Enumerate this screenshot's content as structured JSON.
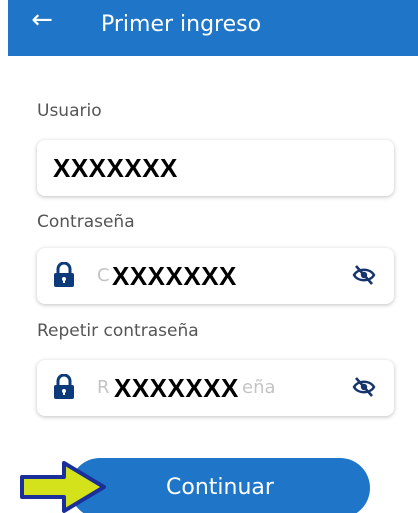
{
  "header": {
    "back_icon": "arrow-left-icon",
    "title": "Primer ingreso"
  },
  "form": {
    "usuario": {
      "label": "Usuario",
      "value": "XXXXXXX"
    },
    "contrasena": {
      "label": "Contraseña",
      "placeholder_visible": "C",
      "masked_overlay": "XXXXXXX",
      "lock_icon": "lock-icon",
      "toggle_icon": "eye-off-icon"
    },
    "repetir": {
      "label": "Repetir contraseña",
      "placeholder_left": "R",
      "placeholder_right": "eña",
      "masked_overlay": "XXXXXXX",
      "lock_icon": "lock-icon",
      "toggle_icon": "eye-off-icon"
    }
  },
  "actions": {
    "continue_label": "Continuar",
    "pointer_icon": "arrow-right-icon"
  },
  "colors": {
    "primary": "#1f75c8",
    "lock": "#0d3a7a",
    "eye": "#16356b",
    "arrow_fill": "#d4e21c",
    "arrow_stroke": "#1a2f9a"
  }
}
